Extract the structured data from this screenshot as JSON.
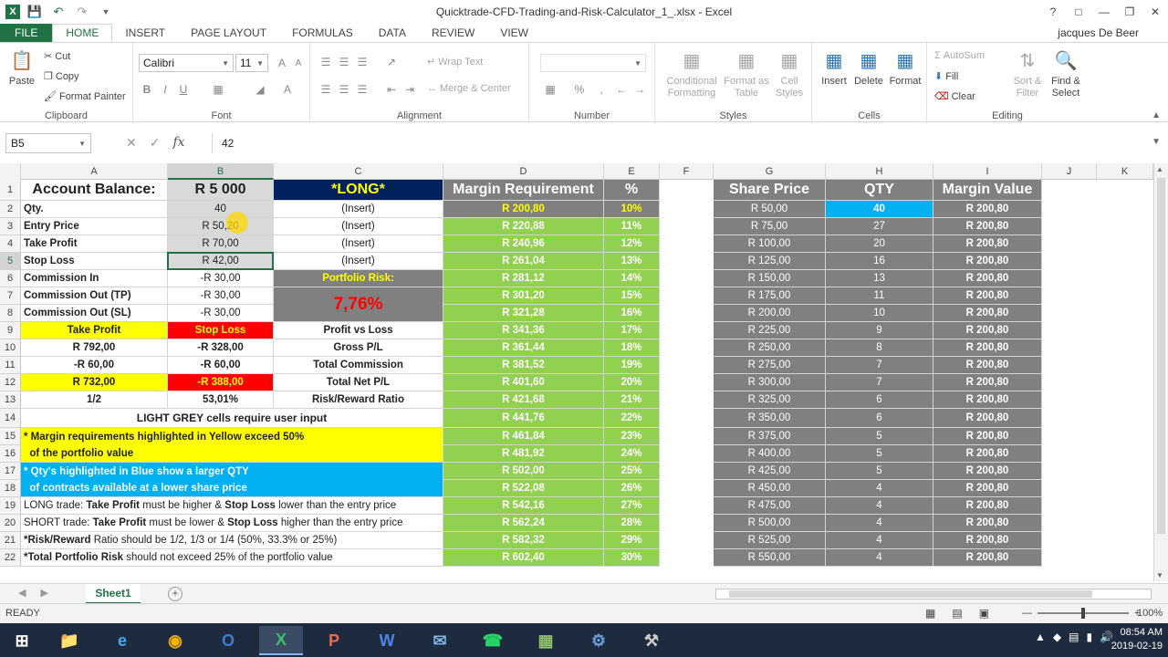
{
  "app": {
    "title": "Quicktrade-CFD-Trading-and-Risk-Calculator_1_.xlsx - Excel",
    "user": "jacques De Beer",
    "help": "?"
  },
  "tabs": [
    "FILE",
    "HOME",
    "INSERT",
    "PAGE LAYOUT",
    "FORMULAS",
    "DATA",
    "REVIEW",
    "VIEW"
  ],
  "ribbon": {
    "clipboard": {
      "label": "Clipboard",
      "paste": "Paste",
      "cut": "Cut",
      "copy": "Copy",
      "format_painter": "Format Painter"
    },
    "font": {
      "label": "Font",
      "name": "Calibri",
      "size": "11",
      "bold": "B",
      "italic": "I",
      "underline": "U"
    },
    "alignment": {
      "label": "Alignment",
      "wrap": "Wrap Text",
      "merge": "Merge & Center"
    },
    "number": {
      "label": "Number",
      "format": ""
    },
    "styles": {
      "label": "Styles",
      "conditional": "Conditional Formatting",
      "format_table": "Format as Table",
      "cell_styles": "Cell Styles"
    },
    "cells": {
      "label": "Cells",
      "insert": "Insert",
      "delete": "Delete",
      "format": "Format"
    },
    "editing": {
      "label": "Editing",
      "autosum": "AutoSum",
      "fill": "Fill",
      "clear": "Clear",
      "sort": "Sort & Filter",
      "find": "Find & Select"
    }
  },
  "formula_bar": {
    "name_box": "B5",
    "value": "42",
    "fx": "fx"
  },
  "columns": [
    "A",
    "B",
    "C",
    "D",
    "E",
    "F",
    "G",
    "H",
    "I",
    "J",
    "K"
  ],
  "rows": [
    "1",
    "2",
    "3",
    "4",
    "5",
    "6",
    "7",
    "8",
    "9",
    "10",
    "11",
    "12",
    "13",
    "14",
    "15",
    "16",
    "17",
    "18",
    "19",
    "20",
    "21",
    "22"
  ],
  "sheet": {
    "left": {
      "a1": "Account Balance:",
      "b1": "R 5 000",
      "c1": "*LONG*",
      "a2": "Qty.",
      "b2": "40",
      "c2": "(Insert)",
      "a3": "Entry Price",
      "b3": "R 50,20",
      "c3": "(Insert)",
      "a4": "Take Profit",
      "b4": "R 70,00",
      "c4": "(Insert)",
      "a5": "Stop Loss",
      "b5": "R 42,00",
      "c5": "(Insert)",
      "a6": "Commission In",
      "b6": "-R 30,00",
      "c6": "Portfolio Risk:",
      "a7": "Commission Out (TP)",
      "b7": "-R 30,00",
      "c7": "7,76%",
      "a8": "Commission Out (SL)",
      "b8": "-R 30,00",
      "a9": "Take Profit",
      "b9": "Stop Loss",
      "c9": "Profit vs Loss",
      "a10": "R 792,00",
      "b10": "-R 328,00",
      "c10": "Gross P/L",
      "a11": "-R 60,00",
      "b11": "-R 60,00",
      "c11": "Total Commission",
      "a12": "R 732,00",
      "b12": "-R 388,00",
      "c12": "Total Net P/L",
      "a13": "1/2",
      "b13": "53,01%",
      "c13": "Risk/Reward Ratio",
      "r14": "LIGHT GREY cells require user input",
      "r15": "* Margin requirements highlighted in Yellow exceed 50%",
      "r16": "  of the portfolio value",
      "r17": "* Qty's highlighted in Blue show a larger QTY",
      "r18": "  of contracts available at a lower share price",
      "r19a": "LONG trade: ",
      "r19b": "Take Profit",
      "r19c": " must be higher & ",
      "r19d": "Stop Loss",
      "r19e": " lower than the entry price",
      "r20a": "SHORT trade: ",
      "r20b": "Take Profit",
      "r20c": " must be lower & ",
      "r20d": "Stop Loss",
      "r20e": " higher than the entry price",
      "r21a": "*Risk/Reward",
      "r21b": " Ratio should be 1/2, 1/3 or 1/4 (50%, 33.3% or 25%)",
      "r22a": "*Total Portfolio Risk",
      "r22b": " should not exceed 25% of the portfolio value"
    },
    "headers": {
      "d": "Margin Requirement",
      "e": "%",
      "g": "Share Price",
      "h": "QTY",
      "i": "Margin Value"
    },
    "margin": [
      "R 200,80",
      "R 220,88",
      "R 240,96",
      "R 261,04",
      "R 281,12",
      "R 301,20",
      "R 321,28",
      "R 341,36",
      "R 361,44",
      "R 381,52",
      "R 401,60",
      "R 421,68",
      "R 441,76",
      "R 461,84",
      "R 481,92",
      "R 502,00",
      "R 522,08",
      "R 542,16",
      "R 562,24",
      "R 582,32",
      "R 602,40"
    ],
    "pct": [
      "10%",
      "11%",
      "12%",
      "13%",
      "14%",
      "15%",
      "16%",
      "17%",
      "18%",
      "19%",
      "20%",
      "21%",
      "22%",
      "23%",
      "24%",
      "25%",
      "26%",
      "27%",
      "28%",
      "29%",
      "30%"
    ],
    "share_price": [
      "R 50,00",
      "R 75,00",
      "R 100,00",
      "R 125,00",
      "R 150,00",
      "R 175,00",
      "R 200,00",
      "R 225,00",
      "R 250,00",
      "R 275,00",
      "R 300,00",
      "R 325,00",
      "R 350,00",
      "R 375,00",
      "R 400,00",
      "R 425,00",
      "R 450,00",
      "R 475,00",
      "R 500,00",
      "R 525,00",
      "R 550,00"
    ],
    "qty": [
      "40",
      "27",
      "20",
      "16",
      "13",
      "11",
      "10",
      "9",
      "8",
      "7",
      "7",
      "6",
      "6",
      "5",
      "5",
      "5",
      "4",
      "4",
      "4",
      "4",
      "4"
    ],
    "margin_value": [
      "R 200,80",
      "R 200,80",
      "R 200,80",
      "R 200,80",
      "R 200,80",
      "R 200,80",
      "R 200,80",
      "R 200,80",
      "R 200,80",
      "R 200,80",
      "R 200,80",
      "R 200,80",
      "R 200,80",
      "R 200,80",
      "R 200,80",
      "R 200,80",
      "R 200,80",
      "R 200,80",
      "R 200,80",
      "R 200,80",
      "R 200,80"
    ]
  },
  "sheet_tab": "Sheet1",
  "status": {
    "ready": "READY",
    "zoom": "100%"
  },
  "taskbar": {
    "time": "08:54 AM",
    "date": "2019-02-19"
  },
  "colors": {
    "green": "#217346",
    "navy": "#002060",
    "yellow": "#ffff00",
    "red": "#ff0000",
    "lime": "#92d050",
    "grey": "#808080",
    "blue": "#00b0f0",
    "lightgrey": "#d9d9d9"
  }
}
